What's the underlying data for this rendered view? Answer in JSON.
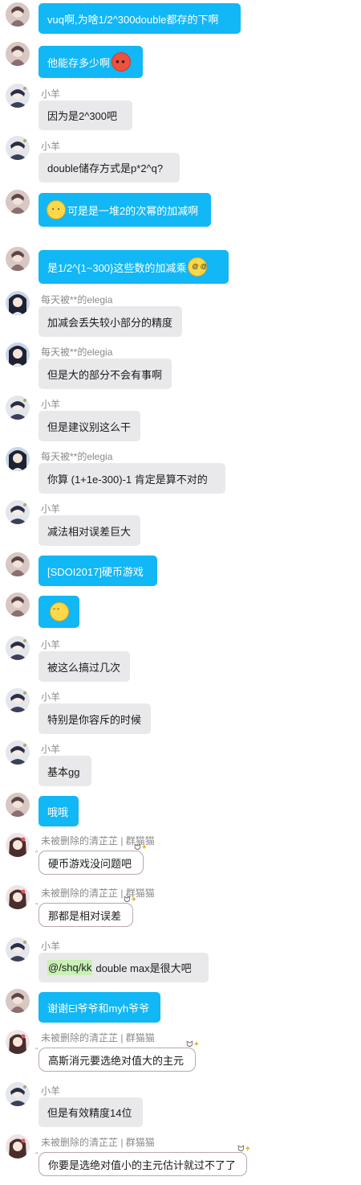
{
  "senders": {
    "xiaoyang": "小羊",
    "elegia": "每天被**的elegia",
    "qingzhi": "未被删除的清芷芷 | 群猫猫"
  },
  "colors": {
    "self_bubble": "#12b7f5",
    "other_bubble": "#e9e9eb",
    "sender_name": "#8a8a8a"
  },
  "messages": [
    {
      "text": "vuq啊,为啥1/2^300double都存的下啊"
    },
    {
      "text": "他能存多少啊",
      "emoji": "shocked-face-icon"
    },
    {
      "sender": "小羊",
      "text": "因为是2^300吧"
    },
    {
      "sender": "小羊",
      "text": "double储存方式是p*2^q?"
    },
    {
      "emoji": "thinking-face-icon",
      "text": "可是是一堆2的次幂的加减啊"
    },
    {
      "text": "是1/2^{1~300}这些数的加减乘",
      "emoji": "dizzy-face-icon"
    },
    {
      "sender": "每天被**的elegia",
      "text": "加减会丢失较小部分的精度"
    },
    {
      "sender": "每天被**的elegia",
      "text": "但是大的部分不会有事啊"
    },
    {
      "sender": "小羊",
      "text": "但是建议别这么干"
    },
    {
      "sender": "每天被**的elegia",
      "text": "你算 (1+1e-300)-1 肯定是算不对的"
    },
    {
      "sender": "小羊",
      "text": "减法相对误差巨大"
    },
    {
      "text": "[SDOI2017]硬币游戏"
    },
    {
      "emoji": "sad-face-icon"
    },
    {
      "sender": "小羊",
      "text": "被这么搞过几次"
    },
    {
      "sender": "小羊",
      "text": "特别是你容斥的时候"
    },
    {
      "sender": "小羊",
      "text": "基本gg"
    },
    {
      "text": "哦哦"
    },
    {
      "sender": "未被删除的清芷芷 | 群猫猫",
      "text": "硬币游戏没问题吧"
    },
    {
      "sender": "未被删除的清芷芷 | 群猫猫",
      "text": "那都是相对误差"
    },
    {
      "sender": "小羊",
      "mention": "@/shq/kk",
      "text": "double max是很大吧"
    },
    {
      "text": "谢谢El爷爷和myh爷爷"
    },
    {
      "sender": "未被删除的清芷芷 | 群猫猫",
      "text": "高斯消元要选绝对值大的主元"
    },
    {
      "sender": "小羊",
      "text": "但是有效精度14位"
    },
    {
      "sender": "未被删除的清芷芷 | 群猫猫",
      "text": "你要是选绝对值小的主元估计就过不了了"
    }
  ]
}
